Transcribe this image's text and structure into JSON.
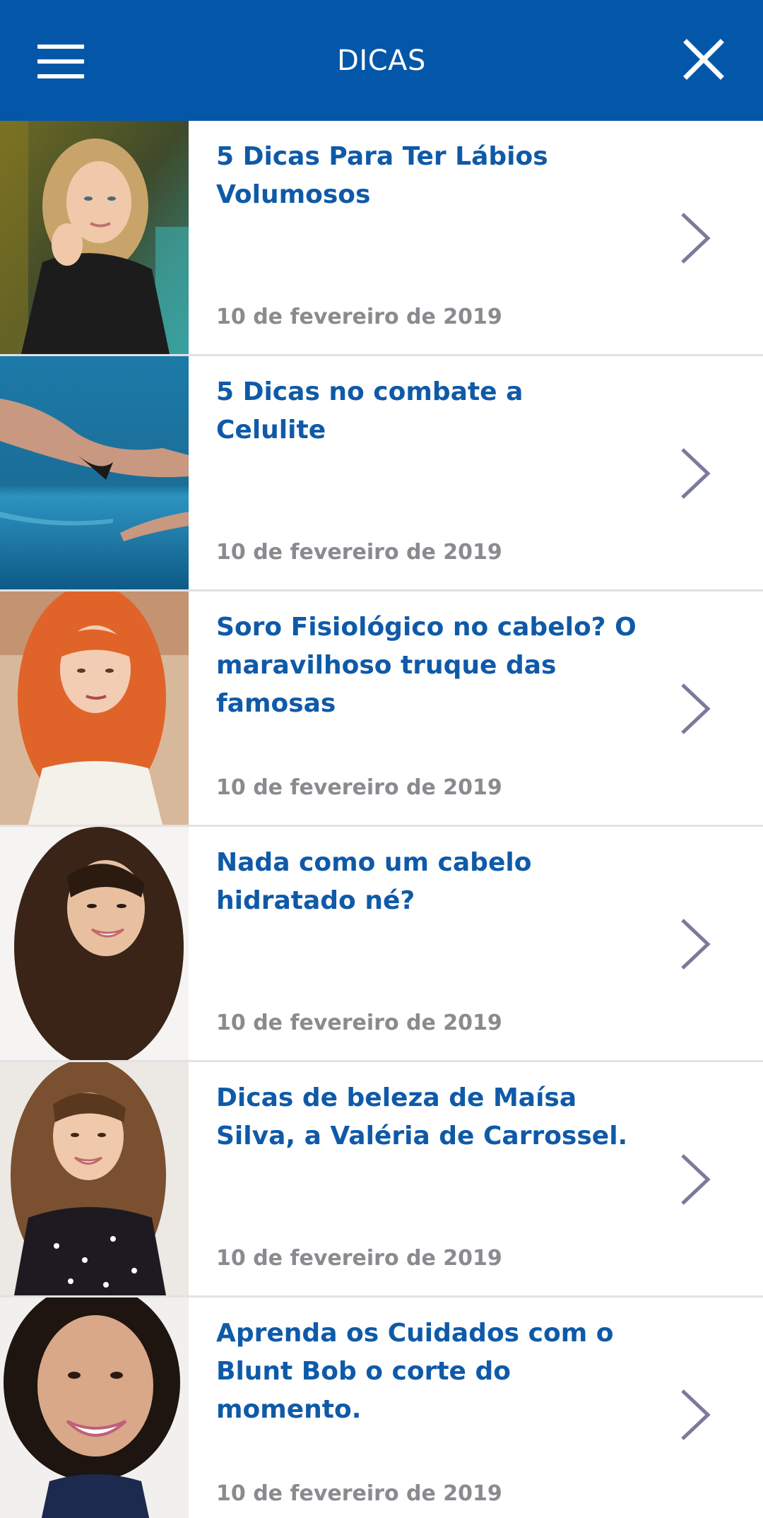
{
  "header": {
    "title": "DICAS",
    "menu_icon": "hamburger-menu-icon",
    "close_icon": "close-icon"
  },
  "colors": {
    "header_bg": "#0457a8",
    "title_text": "#0f5aa8",
    "date_text": "#8a8a8f",
    "chevron": "#7a7a9a",
    "divider": "#e2e2e2"
  },
  "articles": [
    {
      "title": "5 Dicas Para Ter Lábios Volumosos",
      "date": "10 de fevereiro de 2019"
    },
    {
      "title": "5 Dicas no combate a Celulite",
      "date": "10 de fevereiro de 2019"
    },
    {
      "title": "Soro Fisiológico no cabelo? O maravilhoso truque das famosas",
      "date": "10 de fevereiro de 2019"
    },
    {
      "title": "Nada como um cabelo hidratado né?",
      "date": "10 de fevereiro de 2019"
    },
    {
      "title": "Dicas de beleza de Maísa Silva, a Valéria de Carrossel.",
      "date": "10 de fevereiro de 2019"
    },
    {
      "title": "Aprenda os Cuidados com o Blunt Bob o corte do momento.",
      "date": "10 de fevereiro de 2019"
    }
  ]
}
